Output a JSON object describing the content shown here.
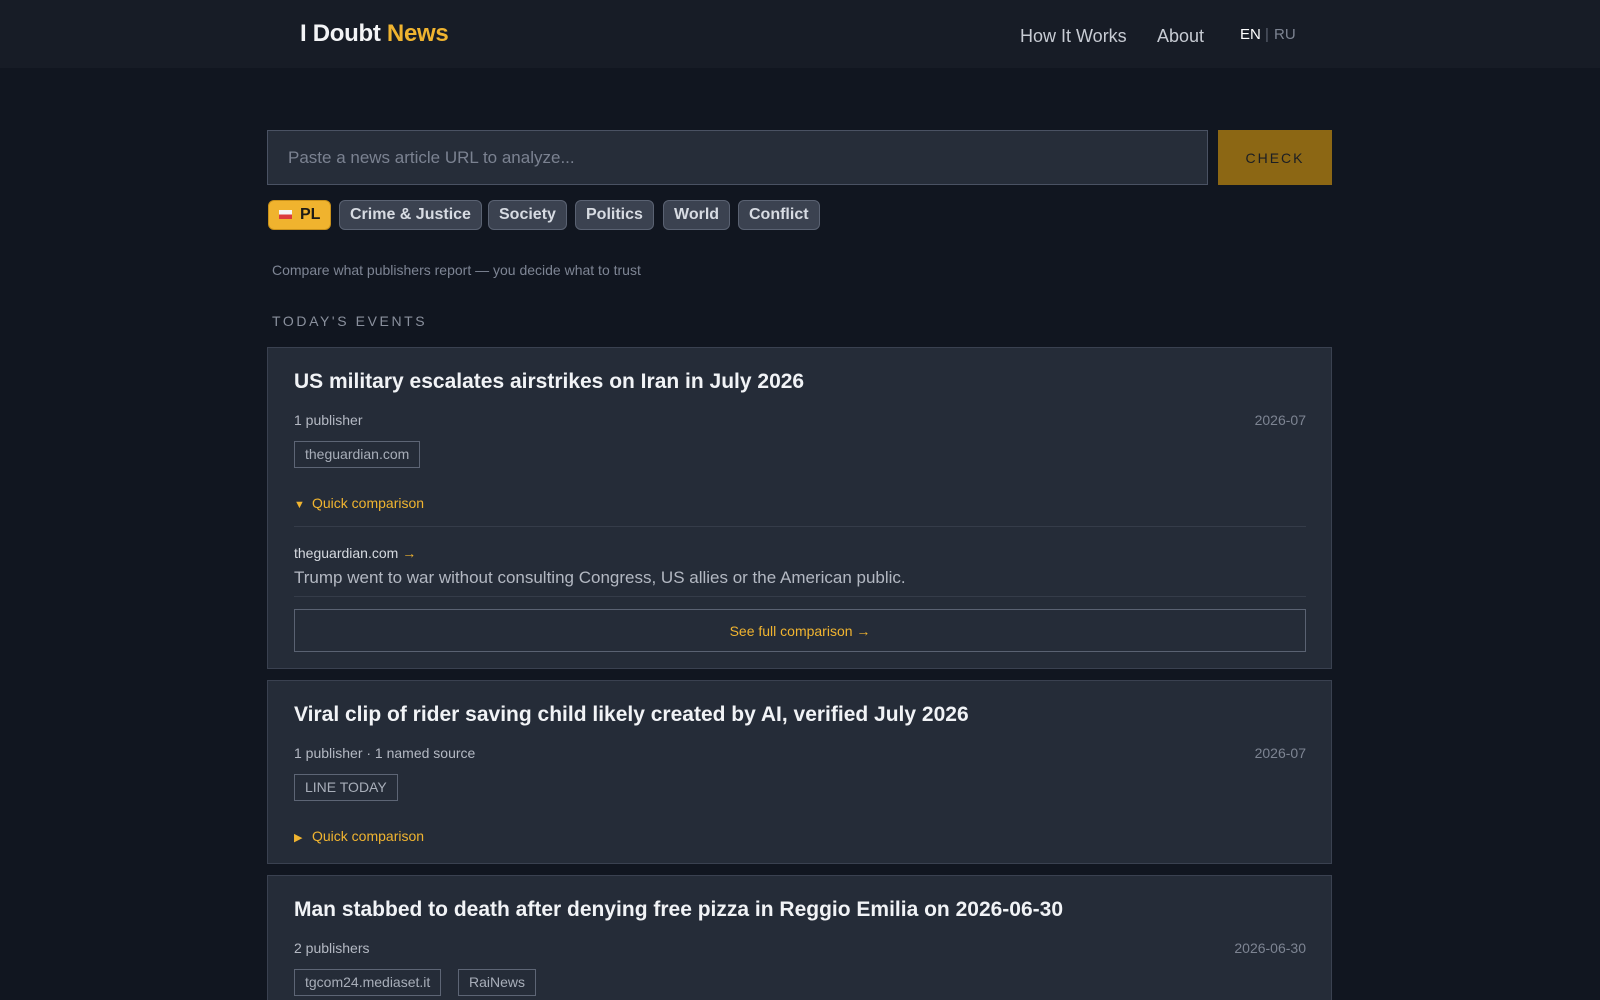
{
  "header": {
    "logo_main": "I Doubt",
    "logo_accent": "News",
    "nav": [
      "How It Works",
      "About"
    ],
    "lang_active": "EN",
    "lang_separator": "|",
    "lang_other": "RU"
  },
  "search": {
    "placeholder": "Paste a news article URL to analyze...",
    "button_label": "CHECK"
  },
  "filters": {
    "region": "PL",
    "topics": [
      "Crime & Justice",
      "Society",
      "Politics",
      "World",
      "Conflict"
    ]
  },
  "tagline": "Compare what publishers report — you decide what to trust",
  "section_title": "TODAY'S EVENTS",
  "events": [
    {
      "title": "US military escalates airstrikes on Iran in July 2026",
      "meta": "1 publisher",
      "date": "2026-07",
      "publishers": [
        "theguardian.com"
      ],
      "toggle_arrow": "▼",
      "toggle_label": "Quick comparison",
      "expanded": true,
      "comparison": {
        "source": "theguardian.com",
        "source_arrow": "→",
        "quote": "Trump went to war without consulting Congress, US allies or the American public.",
        "full_label": "See full comparison →"
      }
    },
    {
      "title": "Viral clip of rider saving child likely created by AI, verified July 2026",
      "meta": "1 publisher · 1 named source",
      "date": "2026-07",
      "publishers": [
        "LINE TODAY"
      ],
      "toggle_arrow": "▶",
      "toggle_label": "Quick comparison",
      "expanded": false
    },
    {
      "title": "Man stabbed to death after denying free pizza in Reggio Emilia on 2026-06-30",
      "meta": "2 publishers",
      "date": "2026-06-30",
      "publishers": [
        "tgcom24.mediaset.it",
        "RaiNews"
      ]
    }
  ],
  "colors": {
    "accent": "#f0b430",
    "background": "#111620",
    "card": "#252c38",
    "check_button": "#8c6714"
  },
  "icons": {
    "region_flag": "poland-flag-icon"
  }
}
